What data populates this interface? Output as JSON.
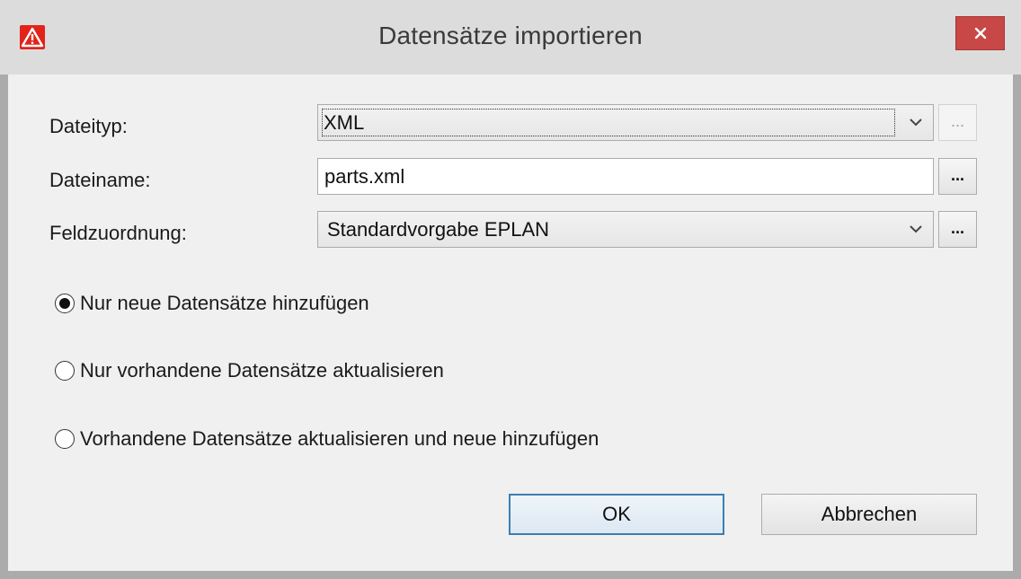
{
  "window": {
    "title": "Datensätze importieren",
    "icon": "eplan-warning-icon",
    "close_icon": "close-icon",
    "close_color": "#c74846",
    "default_button_color": "#3c7fb1"
  },
  "form": {
    "filetype": {
      "label": "Dateityp:",
      "value": "XML",
      "browse": "..."
    },
    "filename": {
      "label": "Dateiname:",
      "value": "parts.xml",
      "browse": "..."
    },
    "mapping": {
      "label": "Feldzuordnung:",
      "value": "Standardvorgabe EPLAN",
      "browse": "..."
    }
  },
  "options": [
    {
      "label": "Nur neue Datensätze hinzufügen",
      "checked": true
    },
    {
      "label": "Nur vorhandene Datensätze aktualisieren",
      "checked": false
    },
    {
      "label": "Vorhandene Datensätze aktualisieren und neue hinzufügen",
      "checked": false
    }
  ],
  "buttons": {
    "ok": "OK",
    "cancel": "Abbrechen"
  }
}
